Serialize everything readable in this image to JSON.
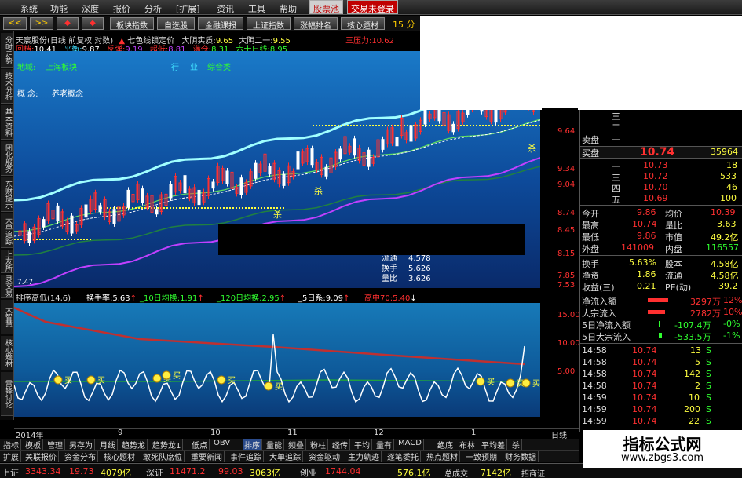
{
  "menu": {
    "items": [
      "系统",
      "功能",
      "深度",
      "报价",
      "分析",
      "[扩展]",
      "资讯",
      "工具",
      "帮助"
    ],
    "stock_pool": "股票池",
    "trade": "交易未登录"
  },
  "toolbar": {
    "buttons": [
      "<<",
      ">>",
      "◆",
      "◆",
      "板块指数",
      "自选股",
      "金融课报",
      "上证指数",
      "涨幅排名",
      "核心题材"
    ],
    "right_label": "15 分"
  },
  "left_tabs": [
    "分时走势",
    "技术分析",
    "基本资料",
    "团化服务",
    "东财提示",
    "大单追踪",
    "上友所",
    "录交易",
    "大智慧",
    "核心题材",
    "雷锋讨论"
  ],
  "info_line1": {
    "stock": "天宸股份(日线 前复权 对数)",
    "indicator": "七色线锁定价",
    "label_a": "大阴实质:",
    "value_a": "9.65",
    "label_b": "大阴二一:",
    "value_b": "9.55",
    "label_c": "三压力:",
    "value_c": "10.62"
  },
  "info_line2": {
    "items": [
      {
        "label": "回档:",
        "value": "10.41"
      },
      {
        "label": "平衡:",
        "value": "9.87"
      },
      {
        "label": "反弹:",
        "value": "9.19"
      },
      {
        "label": "超低:",
        "value": "8.81"
      },
      {
        "label": "满仓:",
        "value": "8.31"
      },
      {
        "label": "六十日线:",
        "value": "8.95"
      }
    ]
  },
  "chart_overlay": {
    "region_label": "地域:",
    "region_value": "上海板块",
    "concept_label": "概  念:",
    "concept_value": "养老概念",
    "line_labels": [
      "行",
      "业",
      "综合类"
    ],
    "sell_label": "杀",
    "low_label": "7.47",
    "stats": [
      {
        "label": "流通",
        "value": "4.578"
      },
      {
        "label": "换手",
        "value": "5.626"
      },
      {
        "label": "量比",
        "value": "3.626"
      }
    ]
  },
  "right_axis_main": [
    "9.64",
    "9.34",
    "9.04",
    "8.74",
    "8.45",
    "8.15",
    "7.85",
    "7.53"
  ],
  "right_axis_sub": [
    "15.00",
    "10.00",
    "5.00"
  ],
  "sub_header": {
    "title": "排序高低(14,6)",
    "items": [
      {
        "label": "换手率:",
        "value": "5.63"
      },
      {
        "label": "_10日均换:",
        "value": "1.91"
      },
      {
        "label": "_120日均换:",
        "value": "2.95"
      },
      {
        "label": "_5日系:",
        "value": "9.09"
      },
      {
        "label": "高中70:",
        "value": "5.40"
      }
    ],
    "buy_label": "买"
  },
  "right_panel": {
    "sell_label": "卖盘",
    "buy_label": "买盘",
    "sell_levels": [
      "三",
      "二",
      "一"
    ],
    "buy_price": "10.74",
    "buy_volume": "35964",
    "buy_levels": [
      {
        "level": "一",
        "price": "10.73",
        "volume": "18"
      },
      {
        "level": "三",
        "price": "10.72",
        "volume": "533"
      },
      {
        "level": "四",
        "price": "10.70",
        "volume": "46"
      },
      {
        "level": "五",
        "price": "10.69",
        "volume": "100"
      }
    ],
    "stats": [
      {
        "l1": "今开",
        "v1": "9.86",
        "l2": "均价",
        "v2": "10.39"
      },
      {
        "l1": "最高",
        "v1": "10.74",
        "l2": "量比",
        "v2": "3.63"
      },
      {
        "l1": "最低",
        "v1": "9.86",
        "l2": "市值",
        "v2": "49.2亿"
      },
      {
        "l1": "外盘",
        "v1": "141009",
        "l2": "内盘",
        "v2": "116557"
      },
      {
        "l1": "换手",
        "v1": "5.63%",
        "l2": "股本",
        "v2": "4.58亿"
      },
      {
        "l1": "净资",
        "v1": "1.86",
        "l2": "流通",
        "v2": "4.58亿"
      },
      {
        "l1": "收益(三)",
        "v1": "0.21",
        "l2": "PE(动)",
        "v2": "39.2"
      }
    ],
    "flows": [
      {
        "label": "净流入额",
        "value": "3297万",
        "pct": "12%"
      },
      {
        "label": "大宗流入",
        "value": "2782万",
        "pct": "10%"
      },
      {
        "label": "5日净流入额",
        "value": "-107.4万",
        "pct": "-0%"
      },
      {
        "label": "5日大宗流入",
        "value": "-533.5万",
        "pct": "-1%"
      }
    ],
    "ticks": [
      {
        "time": "14:58",
        "price": "10.74",
        "vol": "13",
        "side": "S"
      },
      {
        "time": "14:58",
        "price": "10.74",
        "vol": "5",
        "side": "S"
      },
      {
        "time": "14:58",
        "price": "10.74",
        "vol": "142",
        "side": "S"
      },
      {
        "time": "14:58",
        "price": "10.74",
        "vol": "2",
        "side": "S"
      },
      {
        "time": "14:59",
        "price": "10.74",
        "vol": "10",
        "side": "S"
      },
      {
        "time": "14:59",
        "price": "10.74",
        "vol": "200",
        "side": "S"
      },
      {
        "time": "14:59",
        "price": "10.74",
        "vol": "22",
        "side": "S"
      }
    ]
  },
  "date_bar": {
    "year": "2014年",
    "marks": [
      "9",
      "10",
      "11",
      "12",
      "1"
    ],
    "period": "日线"
  },
  "tab_bar1": [
    "指标",
    "模板",
    "管理",
    "另存为",
    "月线",
    "趋势龙",
    "趋势龙1",
    "低点",
    "OBV",
    "排序",
    "量能",
    "频叠",
    "粉柱",
    "经传",
    "平均",
    "量有",
    "MACD",
    "绝底",
    "布林",
    "平均差",
    "杀"
  ],
  "tab_bar2": [
    "扩展",
    "关联报价",
    "资金分布",
    "核心题材",
    "敢死队席位",
    "重要新闻",
    "事件追踪",
    "大单追踪",
    "资金驱动",
    "主力轨迹",
    "逐笔委托",
    "热点题材",
    "一致预期",
    "财务数据"
  ],
  "status_bar": {
    "sh_label": "上证",
    "sh_value": "3343.34",
    "sh_change": "19.73",
    "sh_amount": "4079亿",
    "sz_label": "深证",
    "sz_value": "11471.2",
    "sz_change": "99.03",
    "sz_amount": "3063亿",
    "cy_label": "创业",
    "cy_value": "1744.04",
    "cy_change": "576.1亿",
    "total_label": "总成交",
    "total_value": "7142亿",
    "broker": "招商证"
  },
  "watermark": {
    "title": "指标公式网",
    "url": "www.zbgs3.com"
  },
  "colors": {
    "up": "#ff3030",
    "down": "#30ff30",
    "yellow": "#ffff40",
    "cyan": "#40e0ff",
    "chart_bg": "#0d4a9a"
  }
}
